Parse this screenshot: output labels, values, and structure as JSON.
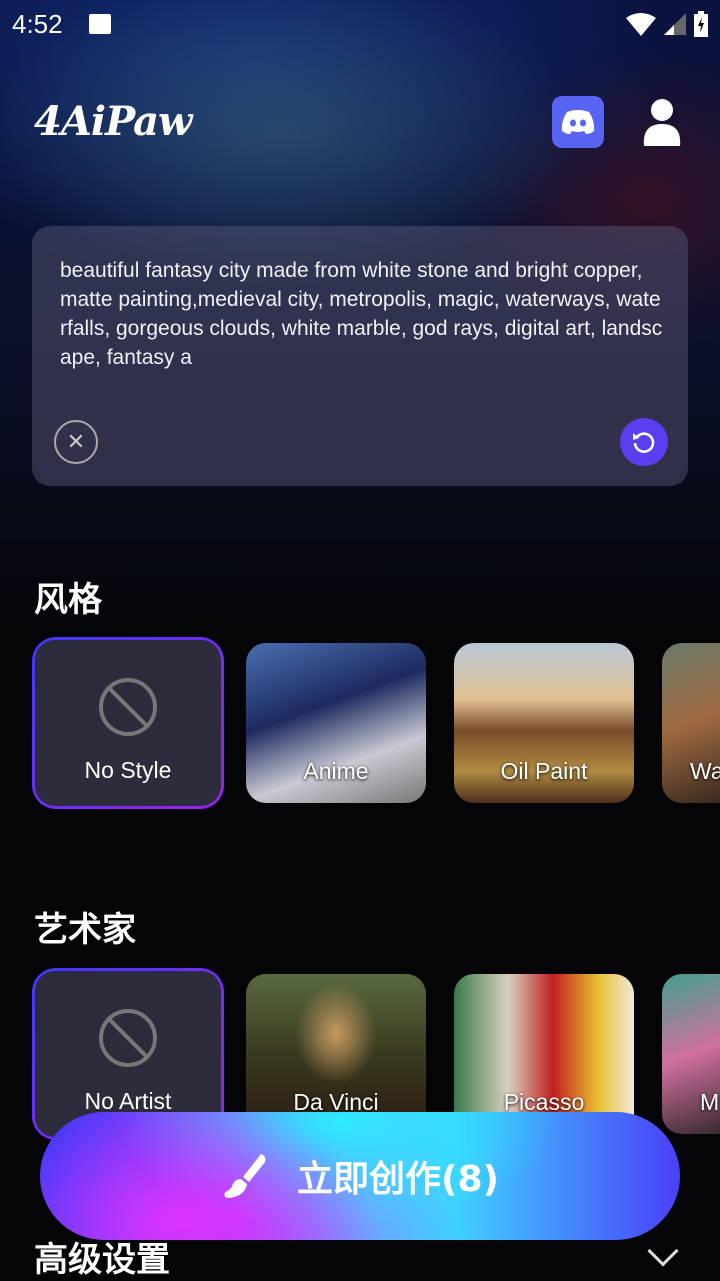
{
  "status_bar": {
    "time": "4:52"
  },
  "header": {
    "logo": "4AiPaw"
  },
  "prompt": {
    "text": "beautiful fantasy city made from white stone and bright copper, matte painting,medieval city, metropolis, magic, waterways, waterfalls, gorgeous clouds, white marble, god rays, digital art, landscape, fantasy a"
  },
  "style_section": {
    "title": "风格",
    "items": [
      {
        "label": "No Style",
        "selected": true
      },
      {
        "label": "Anime"
      },
      {
        "label": "Oil Paint"
      },
      {
        "label": "Wa"
      }
    ]
  },
  "artist_section": {
    "title": "艺术家",
    "items": [
      {
        "label": "No Artist",
        "selected": true
      },
      {
        "label": "Da Vinci"
      },
      {
        "label": "Picasso"
      },
      {
        "label": "M"
      }
    ]
  },
  "create_button": {
    "label": "立即创作(8)"
  },
  "advanced": {
    "title": "高级设置"
  },
  "colors": {
    "accent": "#5a3ff0",
    "discord": "#5865f2"
  }
}
